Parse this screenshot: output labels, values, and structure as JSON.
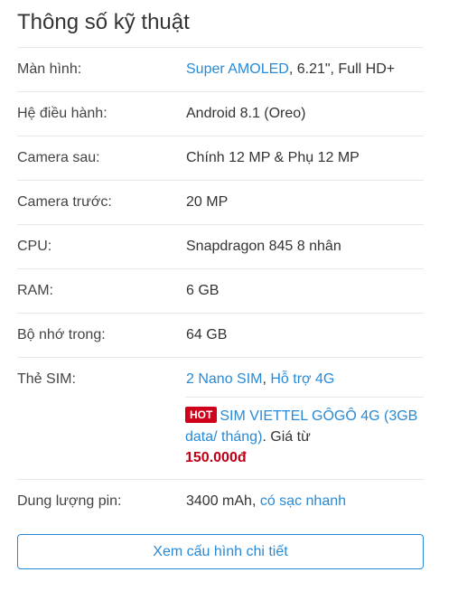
{
  "section_title": "Thông số kỹ thuật",
  "specs": [
    {
      "label": "Màn hình:",
      "value_link": "Super AMOLED",
      "value_rest": ", 6.21\", Full HD+"
    },
    {
      "label": "Hệ điều hành:",
      "value_link": "Android 8.1 (Oreo)"
    },
    {
      "label": "Camera sau:",
      "value": "Chính 12 MP & Phụ 12 MP"
    },
    {
      "label": "Camera trước:",
      "value": "20 MP"
    },
    {
      "label": "CPU:",
      "value_link": "Snapdragon 845 8 nhân"
    },
    {
      "label": "RAM:",
      "value": "6 GB"
    },
    {
      "label": "Bộ nhớ trong:",
      "value": "64 GB"
    },
    {
      "label": "Thẻ SIM:",
      "value_link_1": "2 Nano SIM",
      "separator": ", ",
      "value_link_2": "Hỗ trợ 4G"
    },
    {
      "label": "Dung lượng pin:",
      "value": "3400 mAh",
      "separator": ", ",
      "value_link": "có sạc nhanh"
    }
  ],
  "sim_promo": {
    "badge": "HOT",
    "link_text": "SIM VIETTEL GÔGÔ 4G (3GB data/ tháng)",
    "suffix": ". Giá từ",
    "price": "150.000đ"
  },
  "detail_button": "Xem cấu hình chi tiết",
  "colors": {
    "link": "#288ad6",
    "hot_badge": "#d0021b",
    "price": "#c10017"
  }
}
